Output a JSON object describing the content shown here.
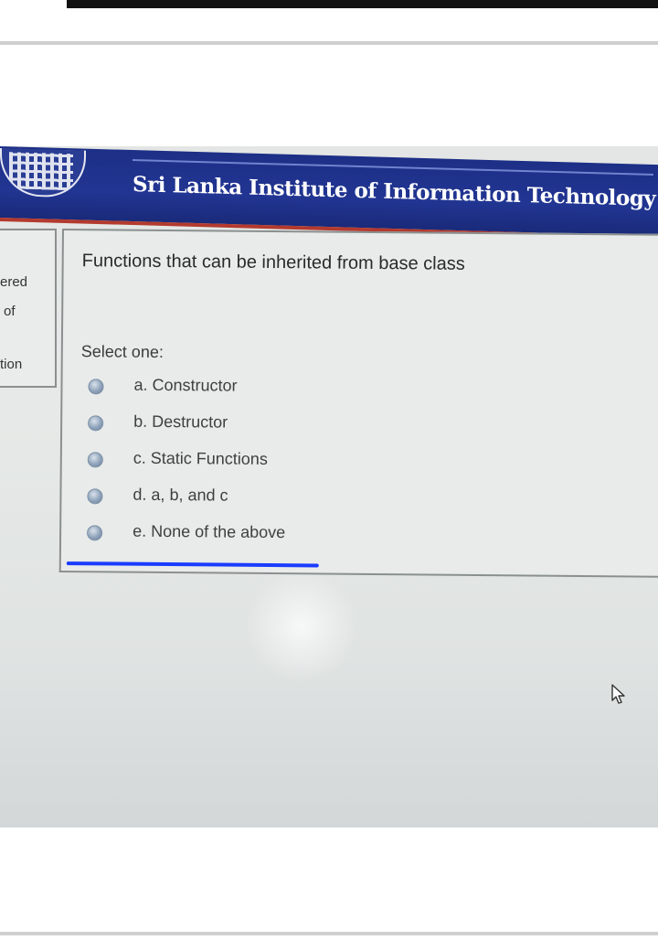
{
  "banner": {
    "title": "Sri Lanka Institute of Information Technology"
  },
  "side_panel": {
    "lines": [
      "ered",
      "of",
      "tion"
    ]
  },
  "question": {
    "text": "Functions that can be inherited from base class",
    "select_label": "Select one:",
    "options": [
      {
        "label": "a. Constructor"
      },
      {
        "label": "b. Destructor"
      },
      {
        "label": "c. Static Functions"
      },
      {
        "label": "d. a, b, and c"
      },
      {
        "label": "e. None of the above"
      }
    ]
  },
  "colors": {
    "banner": "#213592",
    "accent_underline": "#1a3cff"
  }
}
